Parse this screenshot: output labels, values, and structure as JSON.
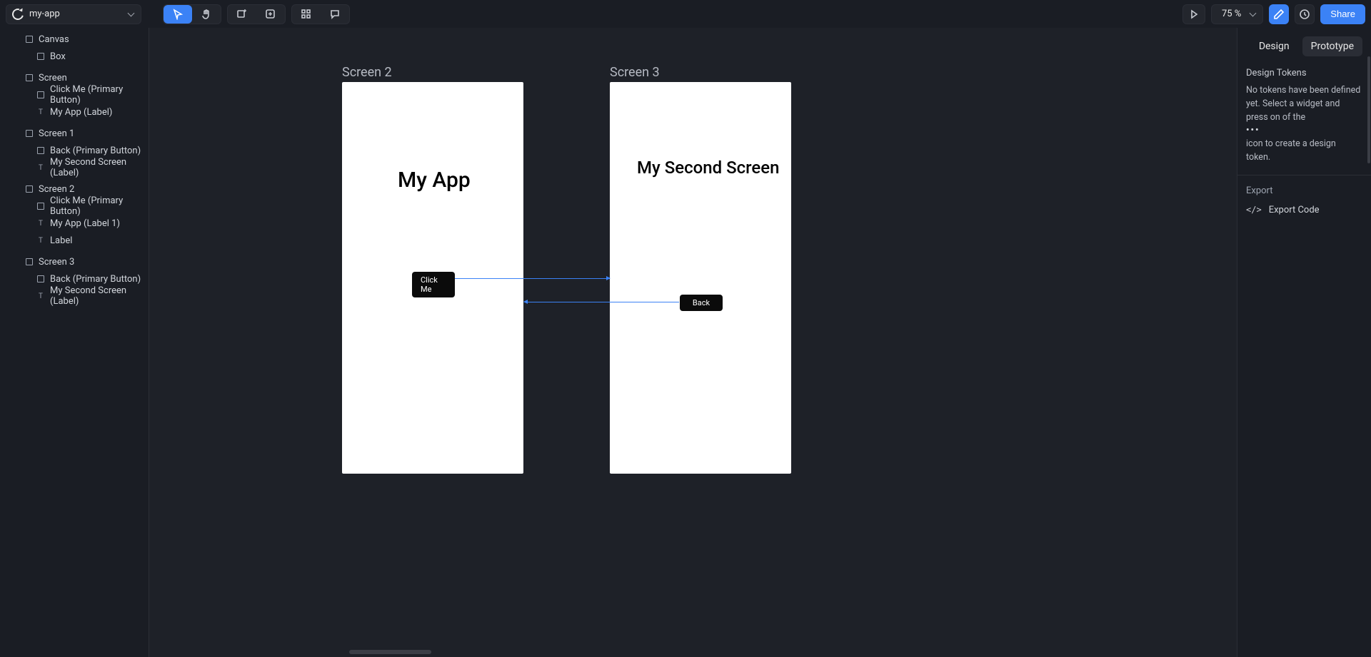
{
  "appName": "my-app",
  "zoom": "75 %",
  "shareLabel": "Share",
  "tabs": {
    "design": "Design",
    "prototype": "Prototype"
  },
  "tokens": {
    "title": "Design Tokens",
    "line1": "No tokens have been defined yet.",
    "line2": "Select a widget and press on of the",
    "dots": "•••",
    "line3": "icon to create a design token."
  },
  "export": {
    "title": "Export",
    "code": "Export Code"
  },
  "tree": [
    {
      "indent": 1,
      "icon": "rect",
      "label": "Canvas"
    },
    {
      "indent": 2,
      "icon": "rect",
      "label": "Box"
    },
    {
      "indent": 1,
      "icon": "rect",
      "label": "Screen"
    },
    {
      "indent": 2,
      "icon": "rect",
      "label": "Click Me (Primary Button)"
    },
    {
      "indent": 2,
      "icon": "text",
      "label": "My App (Label)"
    },
    {
      "indent": 1,
      "icon": "rect",
      "label": "Screen 1"
    },
    {
      "indent": 2,
      "icon": "rect",
      "label": "Back (Primary Button)"
    },
    {
      "indent": 2,
      "icon": "text",
      "label": "My Second Screen (Label)"
    },
    {
      "indent": 1,
      "icon": "rect",
      "label": "Screen 2"
    },
    {
      "indent": 2,
      "icon": "rect",
      "label": "Click Me (Primary Button)"
    },
    {
      "indent": 2,
      "icon": "text",
      "label": "My App (Label 1)"
    },
    {
      "indent": 2,
      "icon": "text",
      "label": "Label"
    },
    {
      "indent": 1,
      "icon": "rect",
      "label": "Screen 3"
    },
    {
      "indent": 2,
      "icon": "rect",
      "label": "Back (Primary Button)"
    },
    {
      "indent": 2,
      "icon": "text",
      "label": "My Second Screen (Label)"
    }
  ],
  "canvas": {
    "screen2": {
      "label": "Screen 2",
      "title": "My App",
      "button": "Click Me"
    },
    "screen3": {
      "label": "Screen 3",
      "title": "My Second Screen",
      "button": "Back"
    }
  }
}
